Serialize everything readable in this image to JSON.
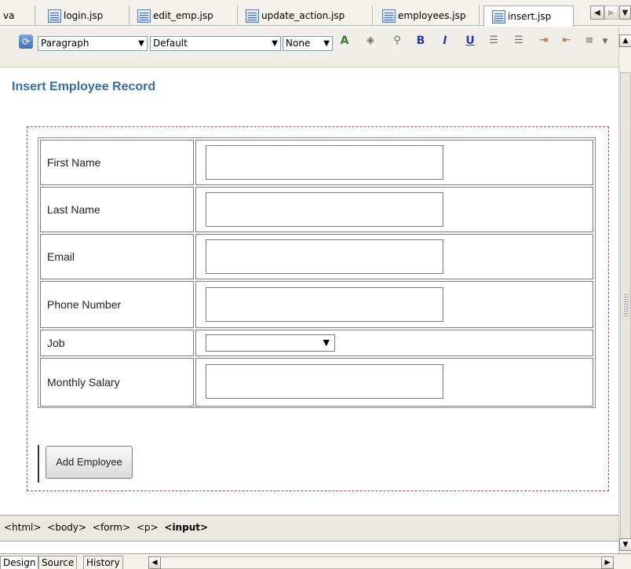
{
  "tabs": [
    {
      "label": "va",
      "active": false
    },
    {
      "label": "login.jsp",
      "active": false
    },
    {
      "label": "edit_emp.jsp",
      "active": false
    },
    {
      "label": "update_action.jsp",
      "active": false
    },
    {
      "label": "employees.jsp",
      "active": false
    },
    {
      "label": "insert.jsp",
      "active": true
    }
  ],
  "toolbar": {
    "block_format": "Paragraph",
    "font": "Default",
    "size": "None",
    "icons": [
      "refresh-icon",
      "text-color-icon",
      "highlight-icon",
      "link-icon",
      "bold-icon",
      "italic-icon",
      "underline-icon",
      "ordered-list-icon",
      "unordered-list-icon",
      "indent-icon",
      "outdent-icon",
      "align-icon"
    ],
    "bold": "B",
    "italic": "I",
    "underline": "U"
  },
  "page": {
    "title": "Insert Employee Record",
    "fields": [
      {
        "label": "First Name",
        "type": "text",
        "value": ""
      },
      {
        "label": "Last Name",
        "type": "text",
        "value": ""
      },
      {
        "label": "Email",
        "type": "text",
        "value": ""
      },
      {
        "label": "Phone Number",
        "type": "text",
        "value": ""
      },
      {
        "label": "Job",
        "type": "select",
        "value": ""
      },
      {
        "label": "Monthly Salary",
        "type": "text",
        "value": ""
      }
    ],
    "submit_label": "Add Employee"
  },
  "breadcrumb": {
    "items": [
      "<html>",
      "<body>",
      "<form>",
      "<p>"
    ],
    "current": "<input>"
  },
  "bottom_tabs": [
    "Design",
    "Source",
    "History"
  ],
  "colors": {
    "title": "#386ea7",
    "form_border": "#e23a3a",
    "toolbar_bg": "#efeee9"
  }
}
